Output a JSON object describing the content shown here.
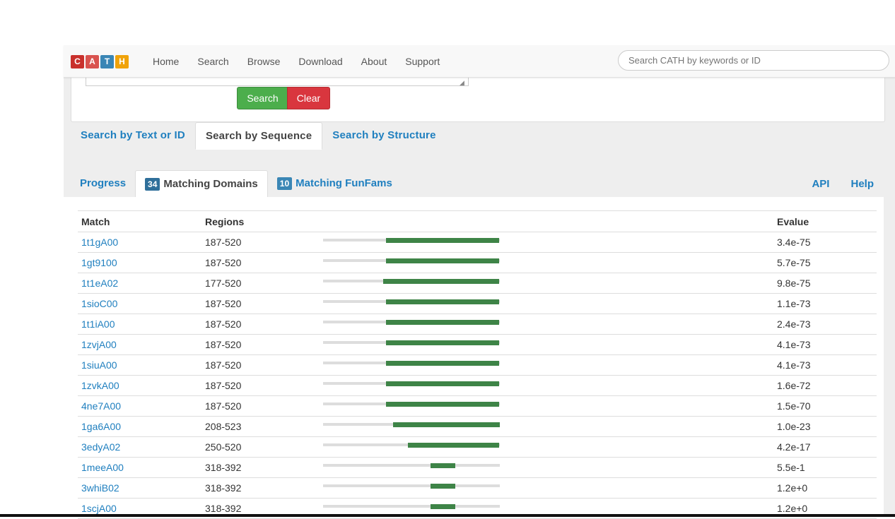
{
  "brand": {
    "letters": [
      "C",
      "A",
      "T",
      "H"
    ],
    "colors": [
      "#c9302c",
      "#d9534f",
      "#3a86b5",
      "#f0a30a"
    ]
  },
  "nav": {
    "links": [
      "Home",
      "Search",
      "Browse",
      "Download",
      "About",
      "Support"
    ],
    "search_placeholder": "Search CATH by keywords or ID"
  },
  "form": {
    "search_label": "Search",
    "clear_label": "Clear"
  },
  "search_tabs": [
    "Search by Text or ID",
    "Search by Sequence",
    "Search by Structure"
  ],
  "result_tabs": {
    "progress": "Progress",
    "domains_count": "34",
    "domains_label": "Matching Domains",
    "funfams_count": "10",
    "funfams_label": "Matching FunFams",
    "api": "API",
    "help": "Help"
  },
  "table": {
    "headers": {
      "match": "Match",
      "regions": "Regions",
      "evalue": "Evalue"
    },
    "sequence_length": 523,
    "rows": [
      {
        "match": "1t1gA00",
        "regions": "187-520",
        "start": 187,
        "end": 520,
        "evalue": "3.4e-75"
      },
      {
        "match": "1gt9100",
        "regions": "187-520",
        "start": 187,
        "end": 520,
        "evalue": "5.7e-75"
      },
      {
        "match": "1t1eA02",
        "regions": "177-520",
        "start": 177,
        "end": 520,
        "evalue": "9.8e-75"
      },
      {
        "match": "1sioC00",
        "regions": "187-520",
        "start": 187,
        "end": 520,
        "evalue": "1.1e-73"
      },
      {
        "match": "1t1iA00",
        "regions": "187-520",
        "start": 187,
        "end": 520,
        "evalue": "2.4e-73"
      },
      {
        "match": "1zvjA00",
        "regions": "187-520",
        "start": 187,
        "end": 520,
        "evalue": "4.1e-73"
      },
      {
        "match": "1siuA00",
        "regions": "187-520",
        "start": 187,
        "end": 520,
        "evalue": "4.1e-73"
      },
      {
        "match": "1zvkA00",
        "regions": "187-520",
        "start": 187,
        "end": 520,
        "evalue": "1.6e-72"
      },
      {
        "match": "4ne7A00",
        "regions": "187-520",
        "start": 187,
        "end": 520,
        "evalue": "1.5e-70"
      },
      {
        "match": "1ga6A00",
        "regions": "208-523",
        "start": 208,
        "end": 523,
        "evalue": "1.0e-23"
      },
      {
        "match": "3edyA02",
        "regions": "250-520",
        "start": 250,
        "end": 520,
        "evalue": "4.2e-17"
      },
      {
        "match": "1meeA00",
        "regions": "318-392",
        "start": 318,
        "end": 392,
        "evalue": "5.5e-1"
      },
      {
        "match": "3whiB02",
        "regions": "318-392",
        "start": 318,
        "end": 392,
        "evalue": "1.2e+0"
      },
      {
        "match": "1scjA00",
        "regions": "318-392",
        "start": 318,
        "end": 392,
        "evalue": "1.2e+0"
      }
    ]
  }
}
